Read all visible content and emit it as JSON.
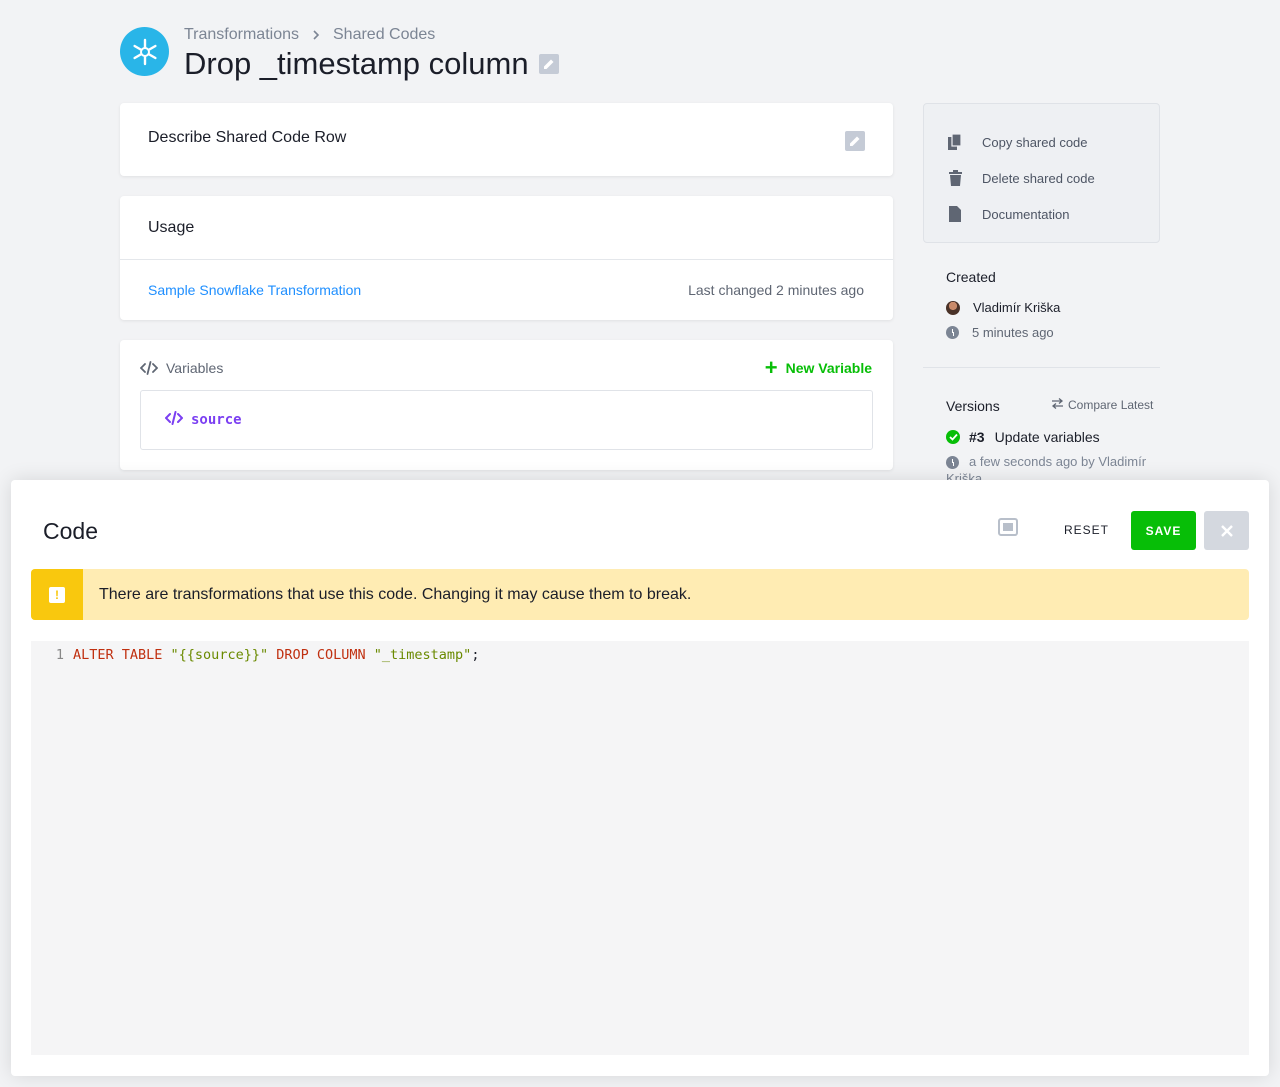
{
  "breadcrumb": {
    "parent": "Transformations",
    "current": "Shared Codes"
  },
  "page": {
    "title": "Drop _timestamp column"
  },
  "describe": {
    "label": "Describe Shared Code Row"
  },
  "usage": {
    "title": "Usage",
    "transformation": "Sample Snowflake Transformation",
    "last_changed": "Last changed 2 minutes ago"
  },
  "variables": {
    "title": "Variables",
    "new_label": "New Variable",
    "items": [
      {
        "name": "source"
      }
    ]
  },
  "actions": [
    {
      "label": "Copy shared code",
      "icon": "copy-icon"
    },
    {
      "label": "Delete shared code",
      "icon": "trash-icon"
    },
    {
      "label": "Documentation",
      "icon": "document-icon"
    }
  ],
  "created": {
    "title": "Created",
    "user": "Vladimír Kriška",
    "time": "5 minutes ago"
  },
  "versions": {
    "title": "Versions",
    "compare_label": "Compare Latest",
    "latest": {
      "number": "#3",
      "title": "Update variables",
      "meta": "a few seconds ago by Vladimír Kriška"
    }
  },
  "modal": {
    "title": "Code",
    "reset_label": "RESET",
    "save_label": "SAVE",
    "warning": "There are transformations that use this code. Changing it may cause them to break.",
    "code": {
      "line_number": "1",
      "tokens": {
        "alter_table": "ALTER TABLE",
        "source": "\"{{source}}\"",
        "drop_column": "DROP COLUMN",
        "column": "\"_timestamp\"",
        "end": ";"
      }
    }
  },
  "colors": {
    "accent": "#07be07",
    "link": "#1f8fff",
    "warning_bg": "#ffecb3",
    "warning_icon": "#f9c80e",
    "variable": "#7b3ff2",
    "snowflake": "#29b5e8"
  }
}
